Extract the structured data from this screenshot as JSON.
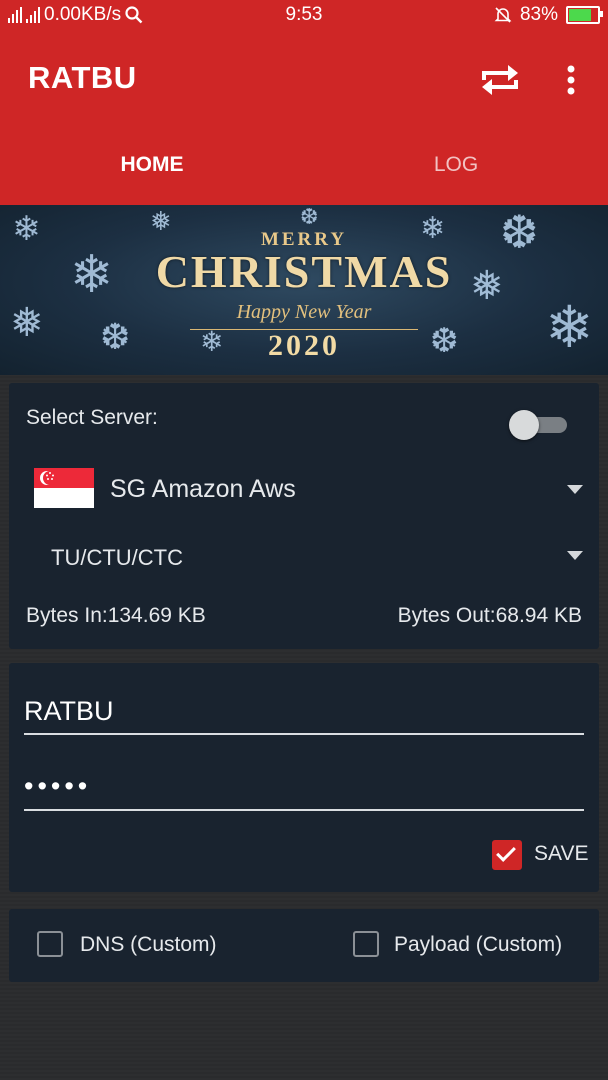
{
  "status_bar": {
    "network_speed": "0.00KB/s",
    "time": "9:53",
    "battery_percent": "83%",
    "battery_level": 0.83,
    "icons": [
      "wifi-signal-icon",
      "cell-signal-icon",
      "search-icon",
      "bell-muted-icon",
      "battery-charging-icon"
    ]
  },
  "app_bar": {
    "title": "RATBU",
    "actions": [
      "sync-icon",
      "more-vert-icon"
    ]
  },
  "tabs": [
    {
      "label": "HOME",
      "selected": true
    },
    {
      "label": "LOG",
      "selected": false
    }
  ],
  "banner": {
    "line1": "MERRY",
    "line2": "CHRISTMAS",
    "line3": "Happy New Year",
    "line4": "2020"
  },
  "server_card": {
    "select_label": "Select Server:",
    "toggle_on": false,
    "server_name": "SG Amazon Aws",
    "flag": "singapore-flag-icon",
    "protocol": "TU/CTU/CTC",
    "bytes_in": "Bytes In:134.69 KB",
    "bytes_out": "Bytes Out:68.94 KB"
  },
  "login_card": {
    "username": "RATBU",
    "password_mask": "•••••",
    "save_label": "SAVE",
    "save_checked": true
  },
  "options_card": {
    "dns_label": "DNS (Custom)",
    "dns_checked": false,
    "payload_label": "Payload (Custom)",
    "payload_checked": false
  },
  "colors": {
    "primary": "#cf2626",
    "card": "#19232f",
    "background": "#2a2b2d"
  }
}
